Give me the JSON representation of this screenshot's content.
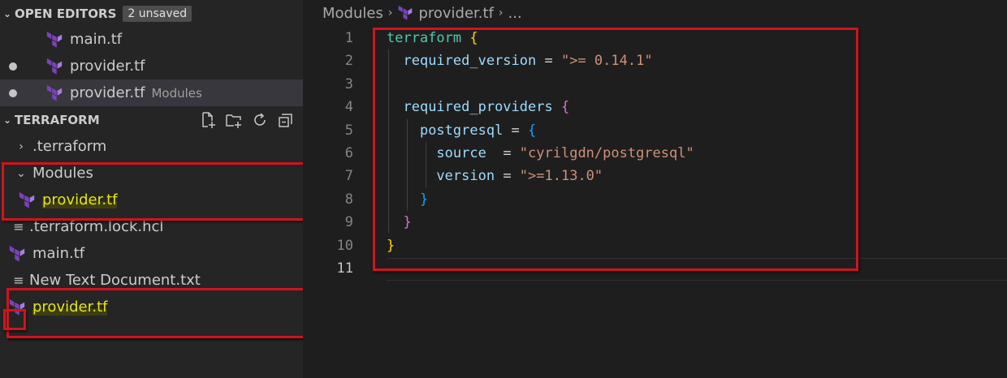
{
  "sidebar": {
    "open_editors": {
      "title": "OPEN EDITORS",
      "badge": "2 unsaved",
      "items": [
        {
          "label": "main.tf",
          "description": ""
        },
        {
          "label": "provider.tf",
          "description": ""
        },
        {
          "label": "provider.tf",
          "description": "Modules"
        }
      ]
    },
    "explorer": {
      "title": "TERRAFORM",
      "items": [
        {
          "label": ".terraform"
        },
        {
          "label": "Modules"
        },
        {
          "label": "provider.tf"
        },
        {
          "label": ".terraform.lock.hcl"
        },
        {
          "label": "main.tf"
        },
        {
          "label": "New Text Document.txt"
        },
        {
          "label": "provider.tf"
        }
      ]
    }
  },
  "editor": {
    "breadcrumb": {
      "folder": "Modules",
      "file": "provider.tf",
      "more": "..."
    },
    "line_numbers": [
      "1",
      "2",
      "3",
      "4",
      "5",
      "6",
      "7",
      "8",
      "9",
      "10",
      "11"
    ],
    "code": {
      "l1_kw": "terraform",
      "l2_attr": "required_version",
      "l2_val": "\">= 0.14.1\"",
      "l4_attr": "required_providers",
      "l5_attr": "postgresql",
      "l6_attr": "source",
      "l6_val": "\"cyrilgdn/postgresql\"",
      "l7_attr": "version",
      "l7_val": "\">=1.13.0\""
    }
  }
}
